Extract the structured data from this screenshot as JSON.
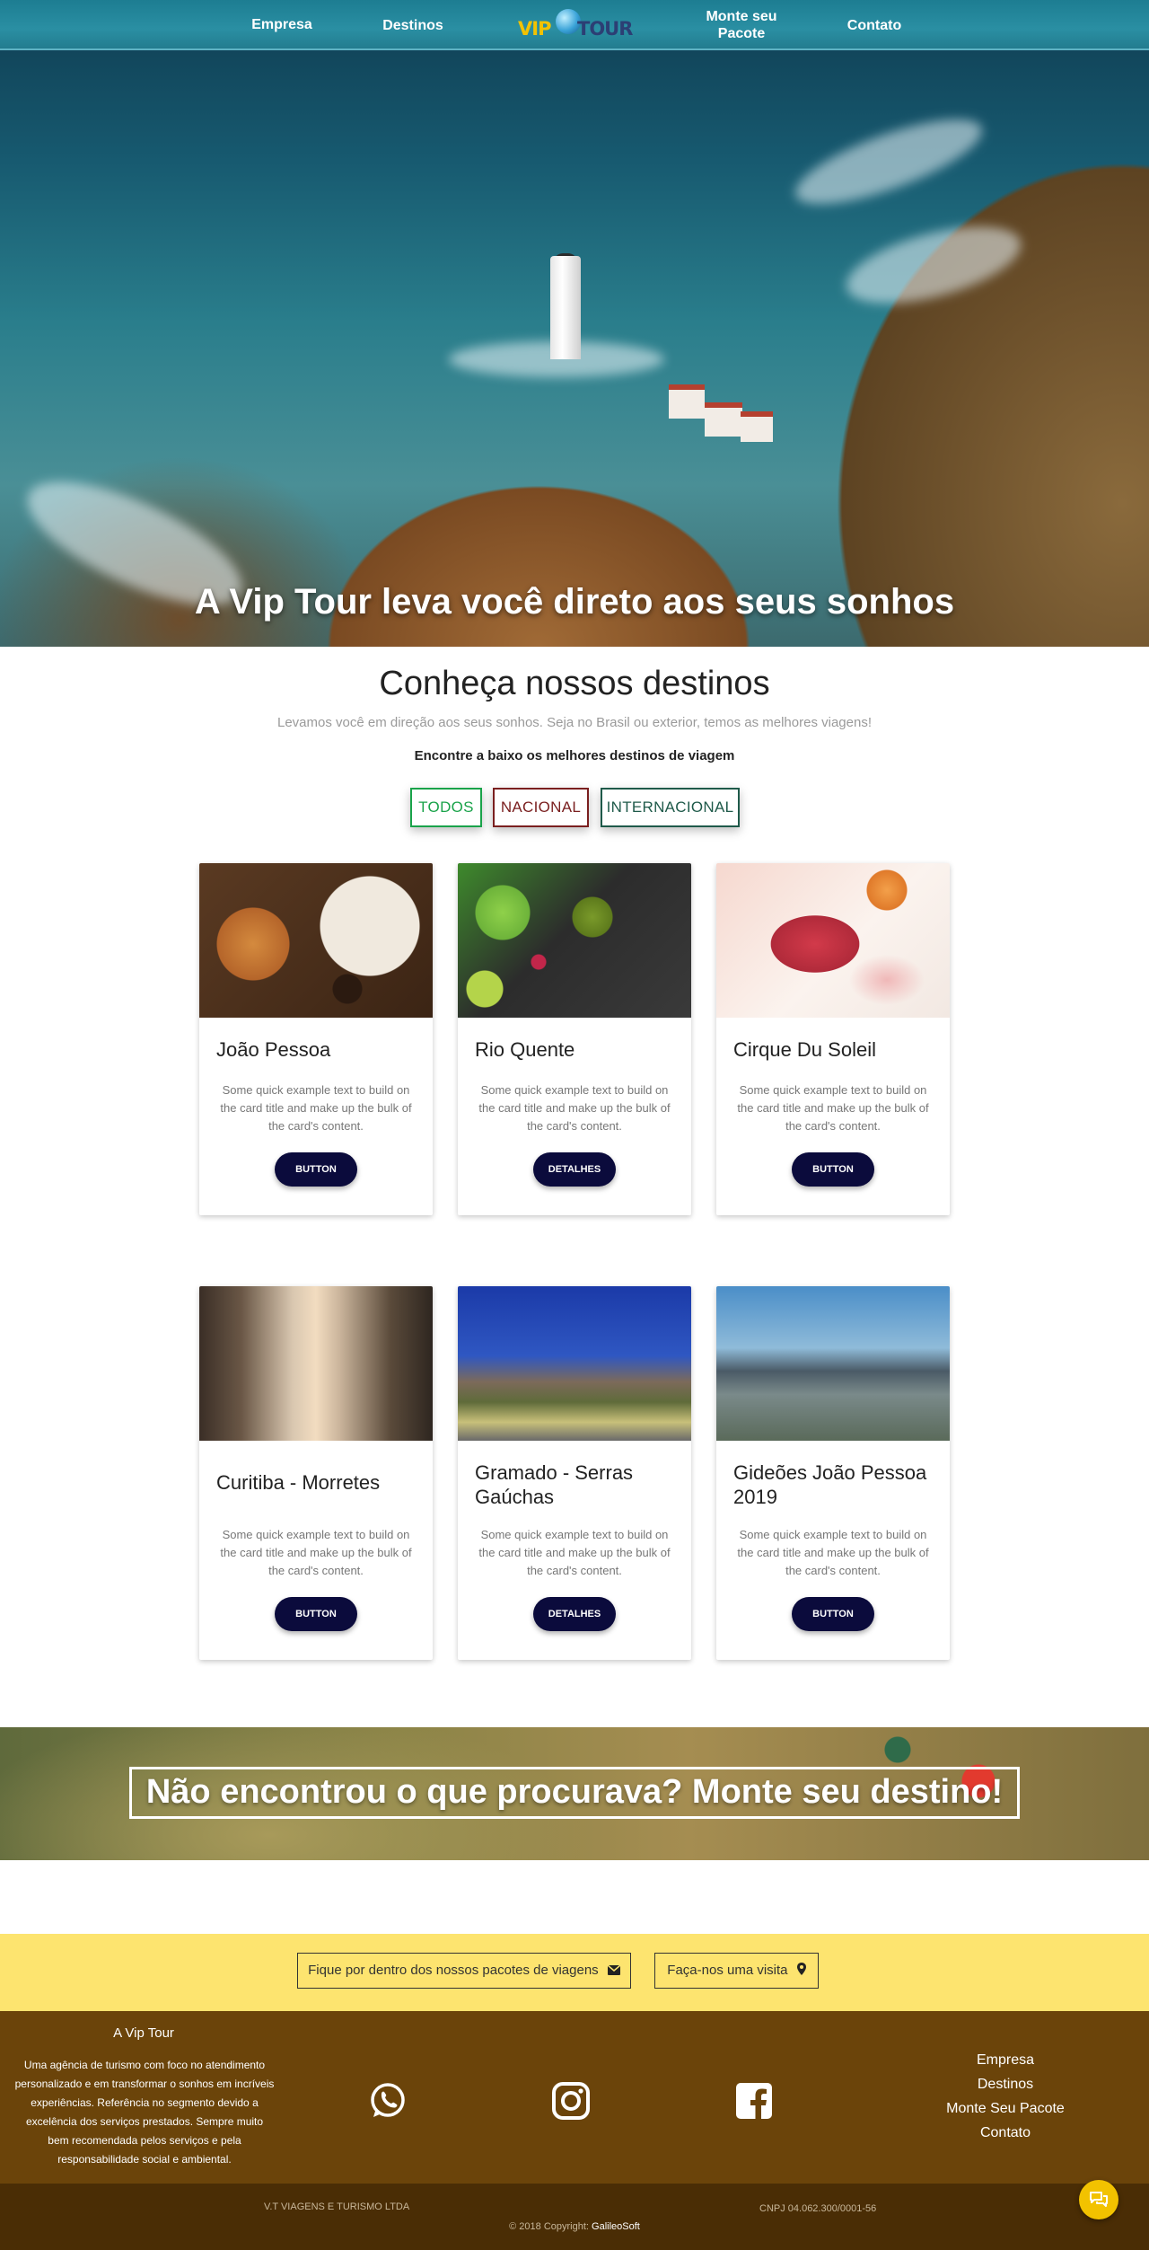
{
  "nav": {
    "items": [
      "Empresa",
      "Destinos",
      "Monte seu Pacote",
      "Contato"
    ],
    "logo_text_1": "VIP",
    "logo_text_2": "TOUR"
  },
  "hero": {
    "title": "A Vip Tour leva você direto aos seus sonhos"
  },
  "destinations": {
    "title": "Conheça nossos destinos",
    "subtitle": "Levamos você em direção aos seus sonhos. Seja no Brasil ou exterior, temos as melhores viagens!",
    "subtitle2": "Encontre a baixo os melhores destinos de viagem",
    "filters": [
      "TODOS",
      "NACIONAL",
      "INTERNACIONAL"
    ]
  },
  "cards": [
    {
      "title": "João Pessoa",
      "text": "Some quick example text to build on the card title and make up the bulk of the card's content.",
      "button": "BUTTON",
      "image": "food-photo"
    },
    {
      "title": "Rio Quente",
      "text": "Some quick example text to build on the card title and make up the bulk of the card's content.",
      "button": "DETALHES",
      "image": "salad-photo"
    },
    {
      "title": "Cirque Du Soleil",
      "text": "Some quick example text to build on the card title and make up the bulk of the card's content.",
      "button": "BUTTON",
      "image": "dessert-photo"
    },
    {
      "title": "Curitiba - Morretes",
      "text": "Some quick example text to build on the card title and make up the bulk of the card's content.",
      "button": "BUTTON",
      "image": "street-photo"
    },
    {
      "title": "Gramado - Serras Gaúchas",
      "text": "Some quick example text to build on the card title and make up the bulk of the card's content.",
      "button": "DETALHES",
      "image": "palms-photo"
    },
    {
      "title": "Gideões João Pessoa 2019",
      "text": "Some quick example text to build on the card title and make up the bulk of the card's content.",
      "button": "BUTTON",
      "image": "city-photo"
    }
  ],
  "banner": {
    "text": "Não encontrou o que procurava? Monte seu destino!"
  },
  "newsletter": {
    "button1": "Fique por dentro dos nossos pacotes de viagens",
    "button2": "Faça-nos uma visita"
  },
  "footer": {
    "title": "A Vip Tour",
    "text": "Uma agência de turismo com foco no atendimento personalizado e em transformar o sonhos em incríveis experiências. Referência no segmento devido a excelência dos serviços prestados. Sempre muito bem recomendada pelos serviços e pela responsabilidade social e ambiental.",
    "social": [
      "whatsapp-icon",
      "instagram-icon",
      "facebook-icon"
    ],
    "links": [
      "Empresa",
      "Destinos",
      "Monte Seu Pacote",
      "Contato"
    ]
  },
  "bottom": {
    "company": "V.T VIAGENS E TURISMO LTDA",
    "cnpj": "CNPJ 04.062.300/0001-56",
    "copyright": "© 2018 Copyright:",
    "copyright_link": "GalileoSoft"
  },
  "colors": {
    "filter_todos": "#1aa34a",
    "filter_nacional": "#7a1f1f",
    "filter_internacional": "#1f5a4a",
    "card_button": "#0b0b3c",
    "newsletter_bg": "#fde46f",
    "footer_bg": "#6b440a",
    "bottom_bg": "#4a2d05",
    "chat_button": "#f2c200"
  }
}
